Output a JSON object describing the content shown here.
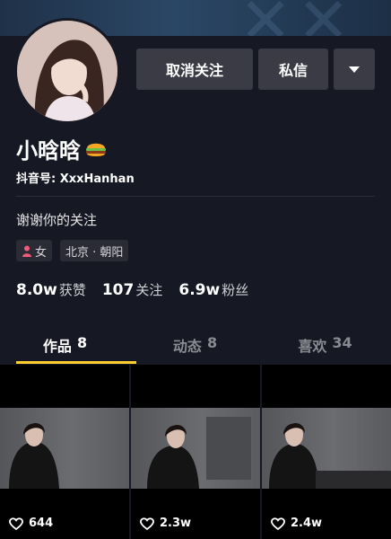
{
  "profile": {
    "name": "小晗晗",
    "name_emoji": "burger-icon",
    "douyin_id": "抖音号: XxxHanhan",
    "bio": "谢谢你的关注",
    "gender_tag": "女",
    "location_tag": "北京 · 朝阳"
  },
  "actions": {
    "unfollow_label": "取消关注",
    "message_label": "私信",
    "more_icon": "caret-down-icon"
  },
  "stats": [
    {
      "value": "8.0w",
      "label": "获赞"
    },
    {
      "value": "107",
      "label": "关注"
    },
    {
      "value": "6.9w",
      "label": "粉丝"
    }
  ],
  "tabs": [
    {
      "label": "作品",
      "count": "8",
      "active": true
    },
    {
      "label": "动态",
      "count": "8",
      "active": false
    },
    {
      "label": "喜欢",
      "count": "34",
      "active": false
    }
  ],
  "videos": [
    {
      "likes": "644"
    },
    {
      "likes": "2.3w"
    },
    {
      "likes": "2.4w"
    }
  ],
  "colors": {
    "background": "#161823",
    "button": "#3a3b45",
    "tab_indicator": "#fecf2e",
    "gender_icon": "#f25a7a"
  }
}
